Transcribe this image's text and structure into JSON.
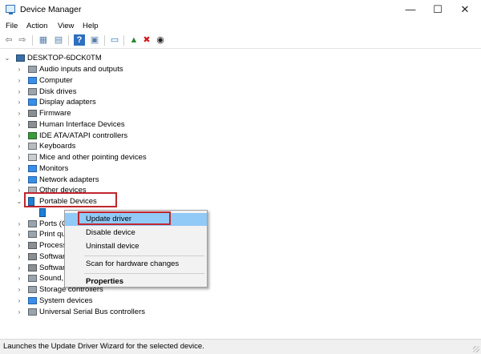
{
  "window": {
    "title": "Device Manager",
    "minimize_glyph": "—",
    "maximize_glyph": "☐",
    "close_glyph": "✕"
  },
  "menu": [
    "File",
    "Action",
    "View",
    "Help"
  ],
  "toolbar": [
    {
      "name": "back-icon",
      "glyph": "⇦"
    },
    {
      "name": "forward-icon",
      "glyph": "⇨"
    },
    {
      "name": "properties-icon",
      "glyph": "▦"
    },
    {
      "name": "show-hide-icon",
      "glyph": "▤"
    },
    {
      "name": "help-icon",
      "glyph": "?"
    },
    {
      "name": "action-pane-icon",
      "glyph": "▣"
    },
    {
      "name": "scan-hardware-icon",
      "glyph": "▭"
    },
    {
      "name": "update-driver-icon",
      "glyph": "▲"
    },
    {
      "name": "uninstall-device-icon",
      "glyph": "✖"
    },
    {
      "name": "disable-device-icon",
      "glyph": "◉"
    }
  ],
  "tree": {
    "root": "DESKTOP-6DCK0TM",
    "items": [
      {
        "label": "Audio inputs and outputs",
        "expanded": false,
        "icon": "speaker-icon"
      },
      {
        "label": "Computer",
        "expanded": false,
        "icon": "computer-icon"
      },
      {
        "label": "Disk drives",
        "expanded": false,
        "icon": "disk-icon"
      },
      {
        "label": "Display adapters",
        "expanded": false,
        "icon": "display-icon"
      },
      {
        "label": "Firmware",
        "expanded": false,
        "icon": "firmware-icon"
      },
      {
        "label": "Human Interface Devices",
        "expanded": false,
        "icon": "hid-icon"
      },
      {
        "label": "IDE ATA/ATAPI controllers",
        "expanded": false,
        "icon": "ide-icon"
      },
      {
        "label": "Keyboards",
        "expanded": false,
        "icon": "keyboard-icon"
      },
      {
        "label": "Mice and other pointing devices",
        "expanded": false,
        "icon": "mouse-icon"
      },
      {
        "label": "Monitors",
        "expanded": false,
        "icon": "monitor-icon"
      },
      {
        "label": "Network adapters",
        "expanded": false,
        "icon": "network-icon"
      },
      {
        "label": "Other devices",
        "expanded": false,
        "icon": "other-devices-icon"
      },
      {
        "label": "Portable Devices",
        "expanded": true,
        "icon": "portable-device-icon"
      },
      {
        "label": "",
        "child": true,
        "icon": "portable-device-icon"
      },
      {
        "label": "Ports (C",
        "expanded": false,
        "icon": "port-icon"
      },
      {
        "label": "Print qu",
        "expanded": false,
        "icon": "printer-icon"
      },
      {
        "label": "Process",
        "expanded": false,
        "icon": "processor-icon"
      },
      {
        "label": "Softwar",
        "expanded": false,
        "icon": "software-icon"
      },
      {
        "label": "Softwar",
        "expanded": false,
        "icon": "software-icon"
      },
      {
        "label": "Sound, v",
        "expanded": false,
        "icon": "sound-icon"
      },
      {
        "label": "Storage controllers",
        "expanded": false,
        "icon": "storage-icon"
      },
      {
        "label": "System devices",
        "expanded": false,
        "icon": "system-icon"
      },
      {
        "label": "Universal Serial Bus controllers",
        "expanded": false,
        "icon": "usb-icon"
      }
    ]
  },
  "context_menu": {
    "update_driver": "Update driver",
    "disable_device": "Disable device",
    "uninstall_device": "Uninstall device",
    "scan_hardware": "Scan for hardware changes",
    "properties": "Properties"
  },
  "status_bar": "Launches the Update Driver Wizard for the selected device.",
  "colors": {
    "highlight_border": "#c0262d",
    "menu_highlight": "#91c9f7"
  }
}
